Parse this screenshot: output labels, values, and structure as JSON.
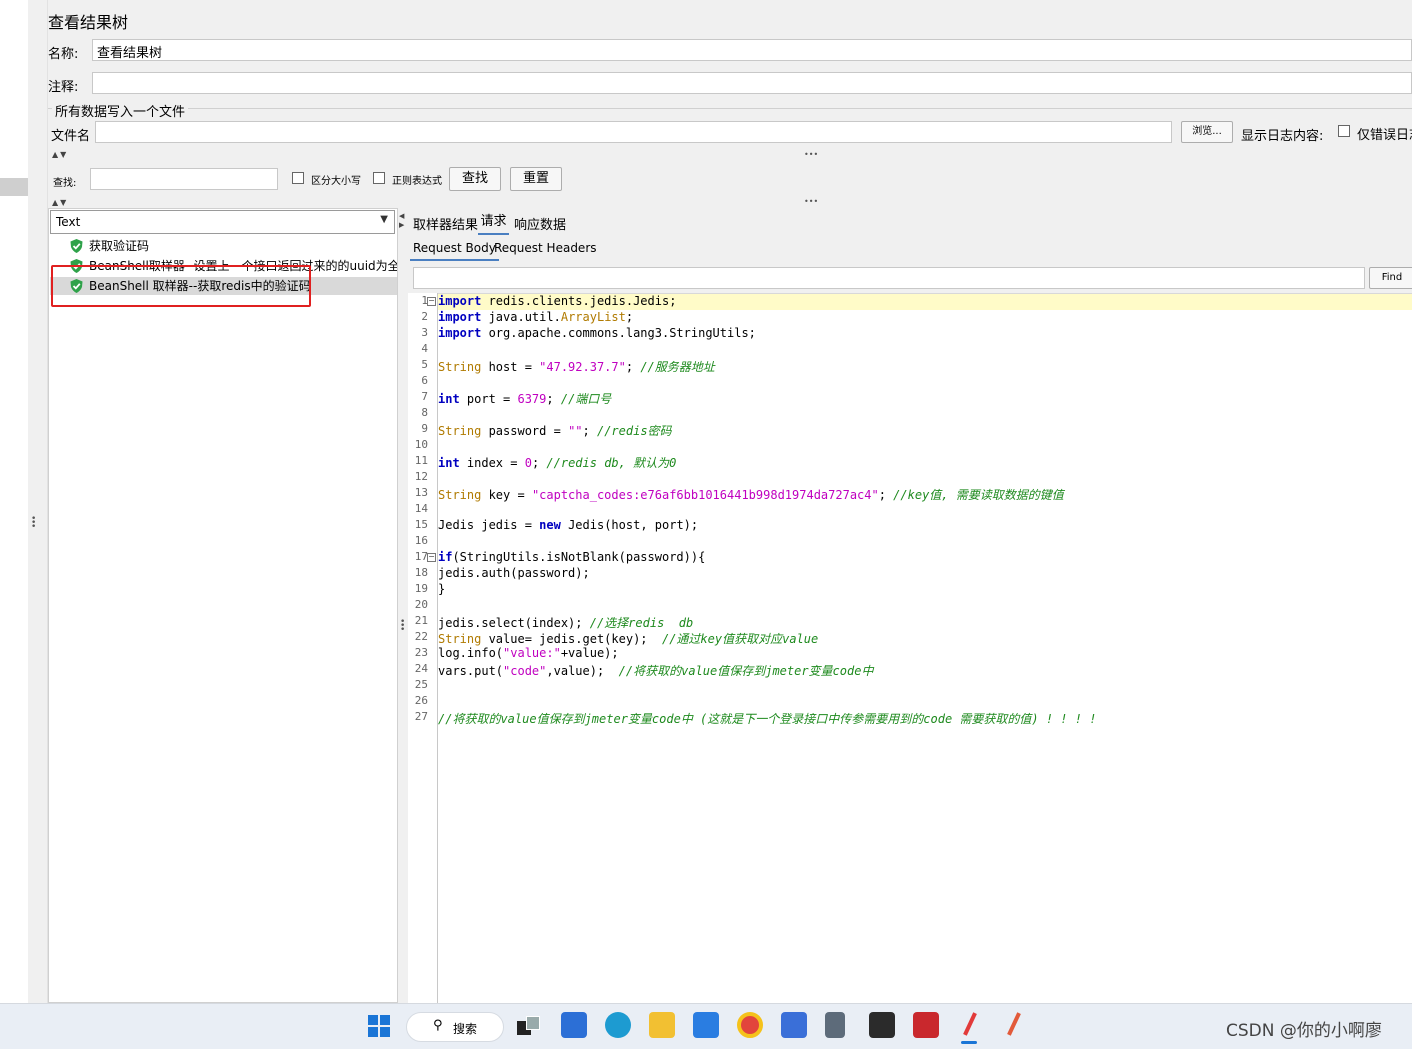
{
  "panel": {
    "title": "查看结果树",
    "name_label": "名称:",
    "name_value": "查看结果树",
    "comment_label": "注释:",
    "comment_value": "",
    "file_group_label": "所有数据写入一个文件",
    "filename_label": "文件名",
    "filename_value": "",
    "browse_label": "浏览...",
    "log_content_label": "显示日志内容:",
    "errors_only_label": "仅错误日志"
  },
  "search": {
    "label": "查找:",
    "value": "",
    "case_sensitive_label": "区分大小写",
    "regex_label": "正则表达式",
    "find_button": "查找",
    "reset_button": "重置"
  },
  "renderer": {
    "selected": "Text"
  },
  "tree": {
    "items": [
      {
        "label": "获取验证码"
      },
      {
        "label": "BeanShell取样器--设置上一个接口返回过来的的uuid为全局"
      },
      {
        "label": "BeanShell 取样器--获取redis中的验证码"
      }
    ]
  },
  "result_tabs": {
    "tabs": [
      "取样器结果",
      "请求",
      "响应数据"
    ],
    "active": "请求",
    "subtabs": [
      "Request Body",
      "Request Headers"
    ],
    "active_subtab": "Request Body",
    "find_button": "Find",
    "find_value": ""
  },
  "code_lines": [
    "import redis.clients.jedis.Jedis;",
    "import java.util.ArrayList;",
    "import org.apache.commons.lang3.StringUtils;",
    "",
    "String host = \"47.92.37.7\"; //服务器地址",
    "",
    "int port = 6379; //端口号",
    "",
    "String password = \"\"; //redis密码",
    "",
    "int index = 0; //redis db, 默认为0",
    "",
    "String key = \"captcha_codes:e76af6bb1016441b998d1974da727ac4\"; //key值, 需要读取数据的键值",
    "",
    "Jedis jedis = new Jedis(host, port);",
    "",
    "if(StringUtils.isNotBlank(password)){",
    "jedis.auth(password);",
    "}",
    "",
    "jedis.select(index); //选择redis  db",
    "String value= jedis.get(key);  //通过key值获取对应value",
    "log.info(\"value:\"+value);",
    "vars.put(\"code\",value);  //将获取的value值保存到jmeter变量code中",
    "",
    "",
    "//将获取的value值保存到jmeter变量code中 (这就是下一个登录接口中传参需要用到的code 需要获取的值) ! ! ! !"
  ],
  "taskbar": {
    "search_label": "搜索",
    "icons": [
      "start-icon",
      "search-icon",
      "task-view-icon",
      "store-icon",
      "edge-icon",
      "explorer-icon",
      "mail-icon",
      "chrome-icon",
      "app-icon",
      "calculator-icon",
      "terminal-icon",
      "redis-icon",
      "pen-icon",
      "pen2-icon"
    ]
  },
  "watermark": "CSDN @你的小啊廖",
  "colors": {
    "keyword": "#0000c0",
    "type": "#b07a00",
    "string": "#c000c0",
    "comment": "#1e8a1e",
    "highlight": "#fffbc8",
    "annotation_box": "#e02020"
  }
}
